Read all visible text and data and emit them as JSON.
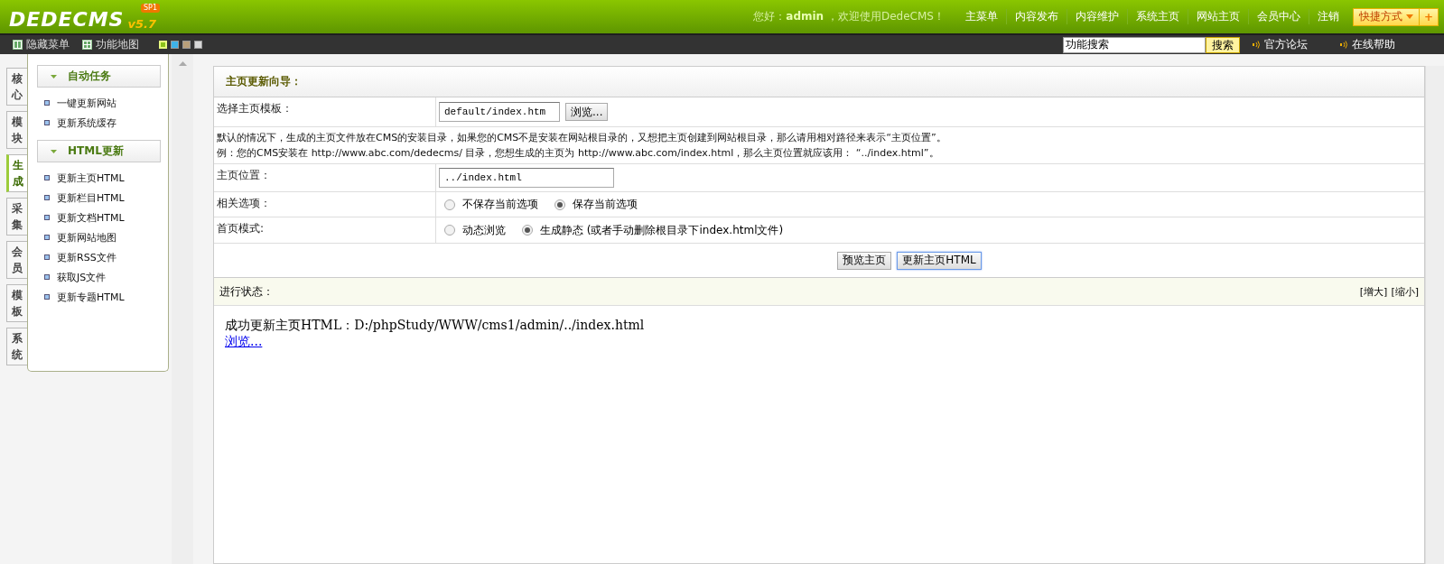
{
  "header": {
    "logo": "DEDECMS",
    "version": "v5.7",
    "badge": "SP1",
    "greeting": "您好：**admin** ，欢迎使用DedeCMS！",
    "nav": [
      "主菜单",
      "内容发布",
      "内容维护",
      "系统主页",
      "网站主页",
      "会员中心",
      "注销"
    ],
    "shortcut": {
      "label": "快捷方式",
      "add": "+"
    }
  },
  "toolbar": {
    "items": [
      {
        "kind": "hide",
        "label": "隐藏菜单"
      },
      {
        "kind": "map",
        "label": "功能地图"
      }
    ],
    "skins": [
      {
        "color": "#8cc21a",
        "selected": true
      },
      {
        "color": "#3eb2e8",
        "selected": false
      },
      {
        "color": "#b9a07a",
        "selected": false
      },
      {
        "color": "#d8d8d8",
        "selected": false
      }
    ],
    "search": {
      "value": "功能搜索",
      "button": "搜索"
    },
    "links": [
      "官方论坛",
      "在线帮助"
    ]
  },
  "side_tabs": [
    {
      "label": "核心",
      "selected": false
    },
    {
      "label": "模块",
      "selected": false
    },
    {
      "label": "生成",
      "selected": true
    },
    {
      "label": "采集",
      "selected": false
    },
    {
      "label": "会员",
      "selected": false
    },
    {
      "label": "模板",
      "selected": false
    },
    {
      "label": "系统",
      "selected": false
    }
  ],
  "menu": [
    {
      "title": "自动任务",
      "items": [
        "一键更新网站",
        "更新系统缓存"
      ]
    },
    {
      "title": "HTML更新",
      "items": [
        "更新主页HTML",
        "更新栏目HTML",
        "更新文档HTML",
        "更新网站地图",
        "更新RSS文件",
        "获取JS文件",
        "更新专题HTML"
      ]
    }
  ],
  "panel": {
    "title": "主页更新向导：",
    "template": {
      "label": "选择主页模板：",
      "value": "default/index.htm",
      "button": "浏览..."
    },
    "note": [
      "默认的情况下，生成的主页文件放在CMS的安装目录，如果您的CMS不是安装在网站根目录的，又想把主页创建到网站根目录，那么请用相对路径来表示“主页位置”。",
      "例：您的CMS安装在 http://www.abc.com/dedecms/ 目录，您想生成的主页为 http://www.abc.com/index.html，那么主页位置就应该用： “../index.html”。"
    ],
    "location": {
      "label": "主页位置：",
      "value": "../index.html"
    },
    "options": {
      "label": "相关选项：",
      "choices": [
        {
          "label": "不保存当前选项",
          "selected": false
        },
        {
          "label": "保存当前选项",
          "selected": true
        }
      ]
    },
    "mode": {
      "label": "首页模式:",
      "choices": [
        {
          "label": "动态浏览",
          "selected": false
        },
        {
          "label": "生成静态 (或者手动删除根目录下index.html文件)",
          "selected": true
        }
      ]
    },
    "buttons": [
      {
        "label": "预览主页",
        "focused": false
      },
      {
        "label": "更新主页HTML",
        "focused": true
      }
    ],
    "status": {
      "label": "进行状态：",
      "actions": [
        "[增大]",
        "[缩小]"
      ]
    },
    "output": {
      "message": "成功更新主页HTML：D:/phpStudy/WWW/cms1/admin/../index.html",
      "link": "浏览..."
    }
  }
}
